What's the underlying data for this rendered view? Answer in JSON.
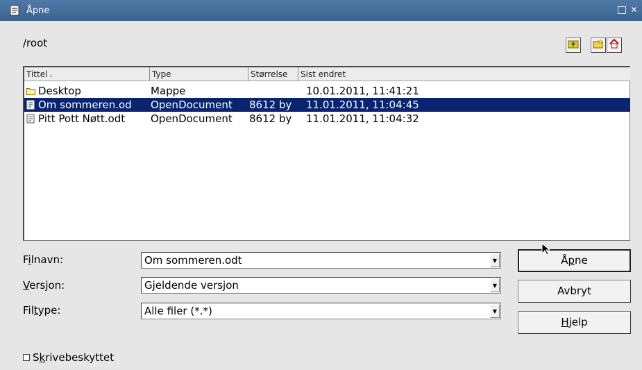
{
  "window": {
    "title": "Åpne"
  },
  "path": "/root",
  "toolbar": {
    "icons": [
      "folder-up-icon",
      "new-folder-icon",
      "home-icon"
    ]
  },
  "filelist": {
    "columns": [
      "Tittel",
      "Type",
      "Størrelse",
      "Sist endret"
    ],
    "rows": [
      {
        "name": "Desktop",
        "type": "Mappe",
        "size": "",
        "modified": "10.01.2011, 11:41:21",
        "icon": "folder-icon",
        "selected": false
      },
      {
        "name": "Om sommeren.od",
        "type": "OpenDocument",
        "size": "8612 by",
        "modified": "11.01.2011, 11:04:45",
        "icon": "document-icon",
        "selected": true
      },
      {
        "name": "Pitt Pott Nøtt.odt",
        "type": "OpenDocument",
        "size": "8612 by",
        "modified": "11.01.2011, 11:04:32",
        "icon": "document-icon",
        "selected": false
      }
    ]
  },
  "form": {
    "filename": {
      "label_pre": "F",
      "label_ul": "i",
      "label_post": "lnavn:",
      "value": "Om sommeren.odt"
    },
    "version": {
      "label_pre": "",
      "label_ul": "V",
      "label_post": "ersjon:",
      "value": "Gjeldende versjon"
    },
    "filetype": {
      "label_pre": "Fil",
      "label_ul": "t",
      "label_post": "ype:",
      "value": "Alle filer (*.*)"
    }
  },
  "buttons": {
    "open": {
      "pre": "Å",
      "ul": "p",
      "post": "ne"
    },
    "cancel": "Avbryt",
    "help": {
      "pre": "",
      "ul": "H",
      "post": "jelp"
    }
  },
  "readonly": {
    "pre": "S",
    "ul": "k",
    "post": "rivebeskyttet",
    "checked": false
  },
  "colors": {
    "titlebar": "#3b638f",
    "selection": "#0a2470"
  }
}
